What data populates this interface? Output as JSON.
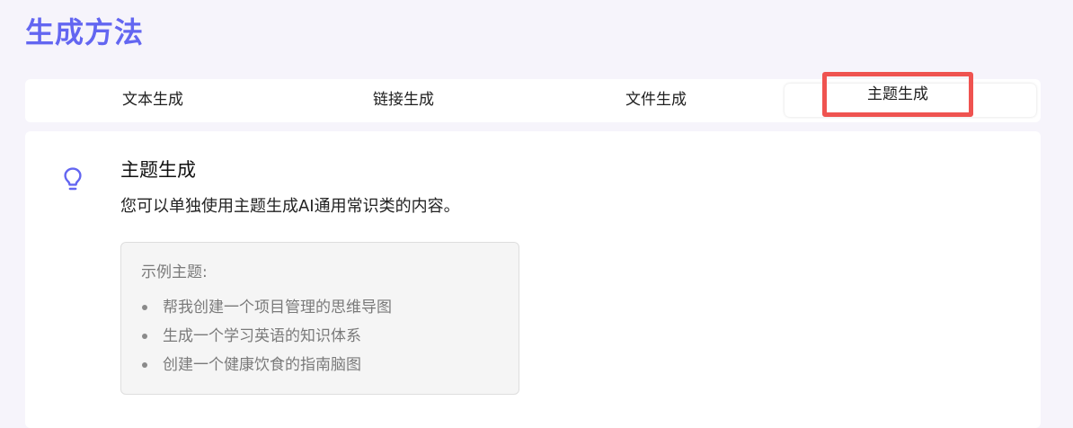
{
  "page": {
    "title": "生成方法"
  },
  "tabs": [
    {
      "label": "文本生成",
      "active": false
    },
    {
      "label": "链接生成",
      "active": false
    },
    {
      "label": "文件生成",
      "active": false
    },
    {
      "label": "主题生成",
      "active": true
    }
  ],
  "content": {
    "icon": "lightbulb-icon",
    "title": "主题生成",
    "description": "您可以单独使用主题生成AI通用常识类的内容。",
    "examples": {
      "heading": "示例主题:",
      "items": [
        "帮我创建一个项目管理的思维导图",
        "生成一个学习英语的知识体系",
        "创建一个健康饮食的指南脑图"
      ]
    }
  },
  "colors": {
    "accent": "#6366f1",
    "highlight": "#ef5350",
    "background": "#f6f4fb"
  }
}
